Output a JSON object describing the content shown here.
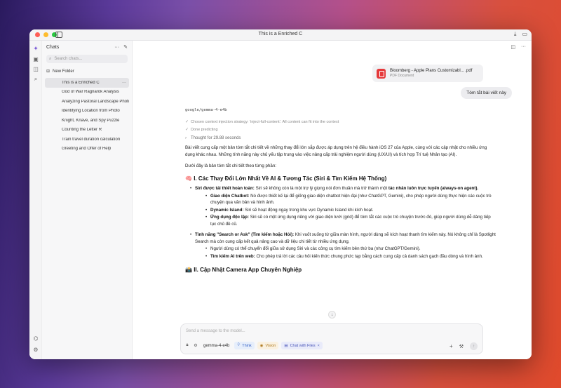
{
  "window": {
    "title": "This is a Enriched C"
  },
  "sidebar": {
    "heading": "Chats",
    "search_placeholder": "Search chats...",
    "new_folder": "New Folder",
    "chats": [
      {
        "title": "This is a Enriched C",
        "active": true
      },
      {
        "title": "God of War Ragnarök Analysis"
      },
      {
        "title": "Analyzing Pastoral Landscape Photogra..."
      },
      {
        "title": "Identifying Location from Photo"
      },
      {
        "title": "Knight, Knave, and Spy Puzzle"
      },
      {
        "title": "Counting the Letter R"
      },
      {
        "title": "Train travel duration calculation"
      },
      {
        "title": "Greeting and Offer of Help"
      }
    ]
  },
  "attachment": {
    "name": "Bloomberg - Apple Plans Customizabl... .pdf",
    "type": "PDF Document"
  },
  "user_message": "Tóm tắt bài viết này",
  "assistant": {
    "model": "google/gemma-4-e4b",
    "status": [
      "Chosen context injection strategy: 'inject-full-content'. All content can fit into the context",
      "Done predicting"
    ],
    "thought": "Thought for 29.88 seconds",
    "intro": "Bài viết cung cấp một bản tóm tắt chi tiết về những thay đổi lớn sắp được áp dụng trên hệ điều hành iOS 27 của Apple, cùng với các cập nhật cho nhiều ứng dụng khác nhau. Những tính năng này chủ yếu tập trung vào việc nâng cấp trải nghiệm người dùng (UX/UI) và tích hợp Trí tuệ Nhân tạo (AI).",
    "lead": "Dưới đây là bản tóm tắt chi tiết theo từng phần:",
    "section1": {
      "emoji": "🧠",
      "title": "I. Các Thay Đổi Lớn Nhất Về AI & Tương Tác (Siri & Tìm Kiếm Hệ Thống)",
      "b1_bold": "Siri được tái thiết hoàn toàn:",
      "b1_text": " Siri sẽ không còn là một trợ lý giọng nói đơn thuần mà trở thành một ",
      "b1_bold2": "tác nhân luôn trực tuyến (always-on agent).",
      "b1_sub": [
        {
          "bold": "Giao diện Chatbot:",
          "text": " Nó được thiết kế lại để giống giao diện chatbot hiện đại (như ChatGPT, Gemini), cho phép người dùng thực hiện các cuộc trò chuyện qua văn bản và hình ảnh."
        },
        {
          "bold": "Dynamic Island:",
          "text": " Siri sẽ hoạt động ngay trong khu vực Dynamic Island khi kích hoạt."
        },
        {
          "bold": "Ứng dụng độc lập:",
          "text": " Siri sẽ có một ứng dụng riêng với giao diện lưới (grid) để tóm tắt các cuộc trò chuyện trước đó, giúp người dùng dễ dàng tiếp tục chủ đề cũ."
        }
      ],
      "b2_bold": "Tính năng \"Search or Ask\" (Tìm kiếm hoặc Hỏi):",
      "b2_text": " Khi vuốt xuống từ giữa màn hình, người dùng sẽ kích hoạt thanh tìm kiếm này. Nó không chỉ là Spotlight Search mà còn cung cấp kết quả nâng cao và dữ liệu chi tiết từ nhiều ứng dụng.",
      "b2_sub": [
        {
          "bold": "",
          "text": "Người dùng có thể chuyển đổi giữa sử dụng Siri và các công cụ tìm kiếm bên thứ ba (như ChatGPT/Gemini)."
        },
        {
          "bold": "Tìm kiếm AI trên web:",
          "text": " Cho phép trả lời các câu hỏi kiến thức chung phức tạp bằng cách cung cấp cả danh sách gạch đầu dòng và hình ảnh."
        }
      ]
    },
    "section2": {
      "emoji": "📸",
      "title": "II. Cập Nhật Camera App Chuyên Nghiệp"
    }
  },
  "composer": {
    "placeholder": "Send a message to the model...",
    "model": "gemma-4-e4b",
    "chips": {
      "think": "Think",
      "vision": "Vision",
      "files": "Chat with Files"
    }
  }
}
